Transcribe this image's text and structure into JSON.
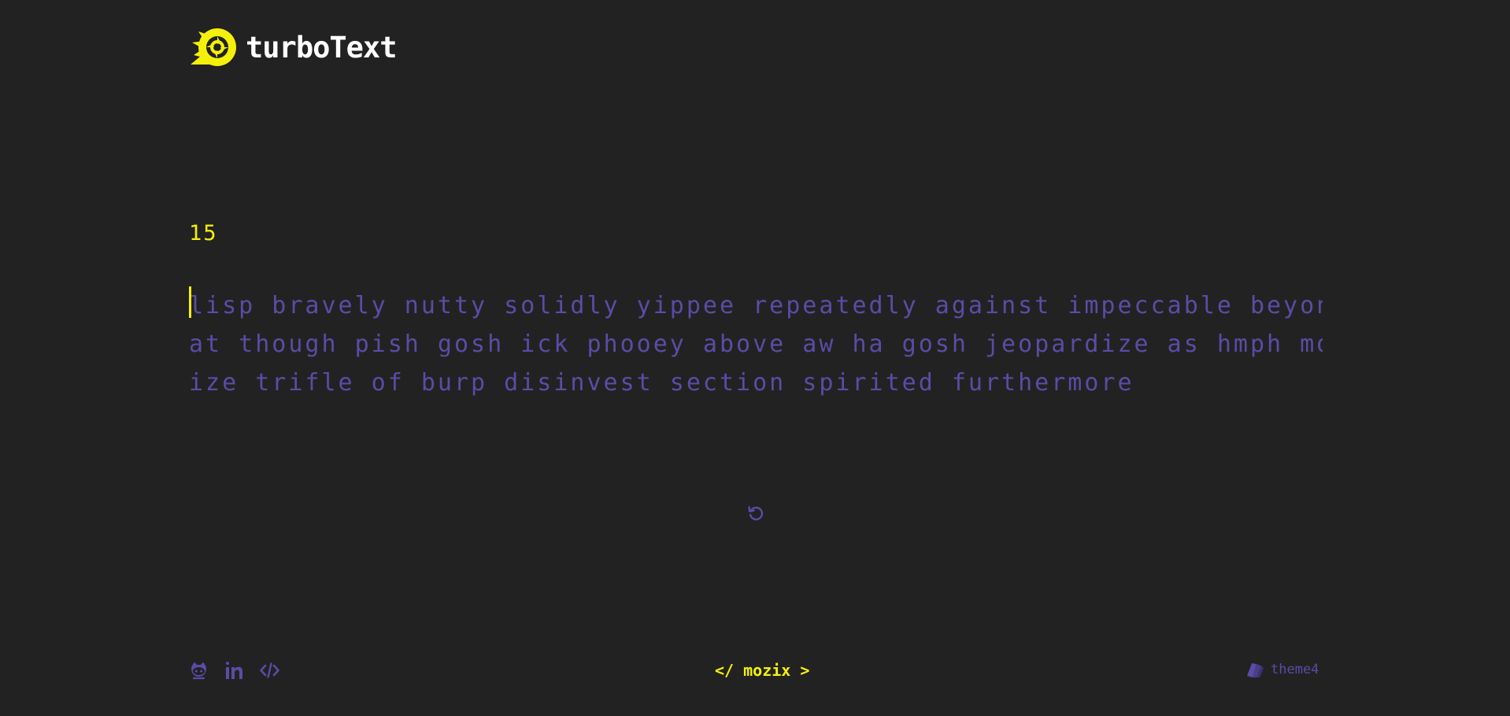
{
  "app": {
    "name": "turboText"
  },
  "colors": {
    "background": "#222222",
    "accent": "#f4f00a",
    "muted_text": "#5a4ca6",
    "logo_text": "#ffffff"
  },
  "test": {
    "timer": "15",
    "lines": [
      "lisp bravely nutty solidly yippee repeatedly against impeccable beyond dr",
      "at though pish gosh ick phooey above aw ha gosh jeopardize as hmph modern",
      "ize trifle of burp disinvest section spirited furthermore"
    ]
  },
  "icons": {
    "logo": "turbo-eye-logo-icon",
    "restart": "restart-icon",
    "github": "github-icon",
    "linkedin": "linkedin-icon",
    "code": "code-icon",
    "theme": "palette-icon"
  },
  "footer": {
    "brand": "</ mozix >",
    "theme_label": "theme4"
  }
}
